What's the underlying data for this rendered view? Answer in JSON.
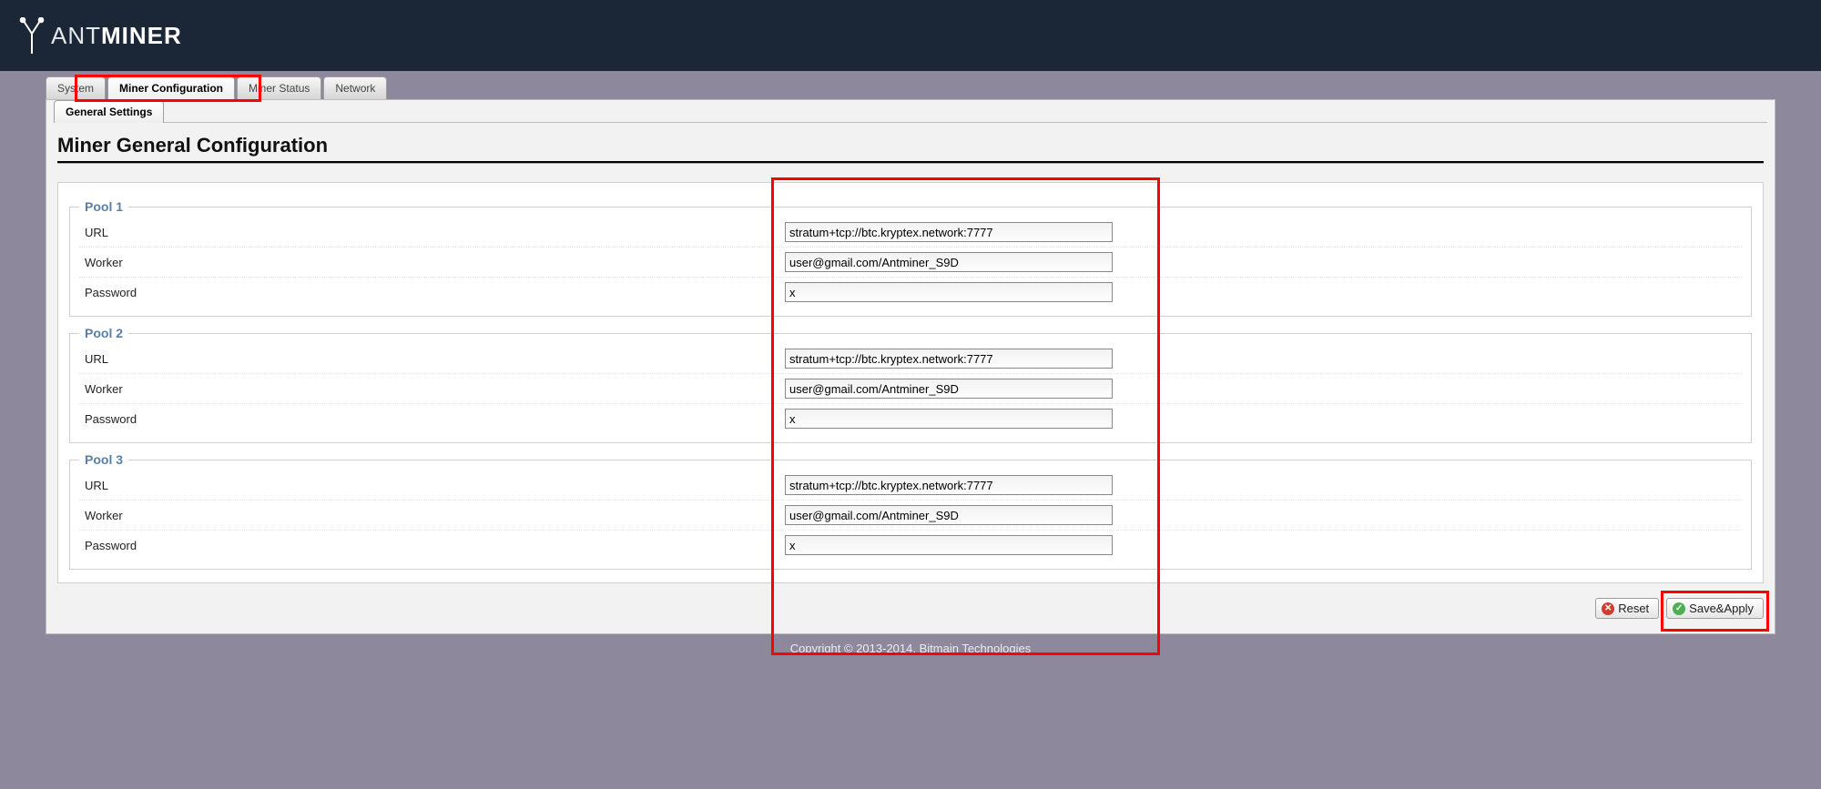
{
  "brand": {
    "thin": "ANT",
    "bold": "MINER"
  },
  "tabs": {
    "system": "System",
    "minerconf": "Miner Configuration",
    "minerstatus": "Miner Status",
    "network": "Network"
  },
  "subtabs": {
    "general": "General Settings"
  },
  "title": "Miner General Configuration",
  "labels": {
    "url": "URL",
    "worker": "Worker",
    "password": "Password"
  },
  "pools": [
    {
      "legend": "Pool 1",
      "url": "stratum+tcp://btc.kryptex.network:7777",
      "worker": "user@gmail.com/Antminer_S9D",
      "password": "x"
    },
    {
      "legend": "Pool 2",
      "url": "stratum+tcp://btc.kryptex.network:7777",
      "worker": "user@gmail.com/Antminer_S9D",
      "password": "x"
    },
    {
      "legend": "Pool 3",
      "url": "stratum+tcp://btc.kryptex.network:7777",
      "worker": "user@gmail.com/Antminer_S9D",
      "password": "x"
    }
  ],
  "buttons": {
    "reset": "Reset",
    "save": "Save&Apply"
  },
  "footer": "Copyright © 2013-2014, Bitmain Technologies"
}
